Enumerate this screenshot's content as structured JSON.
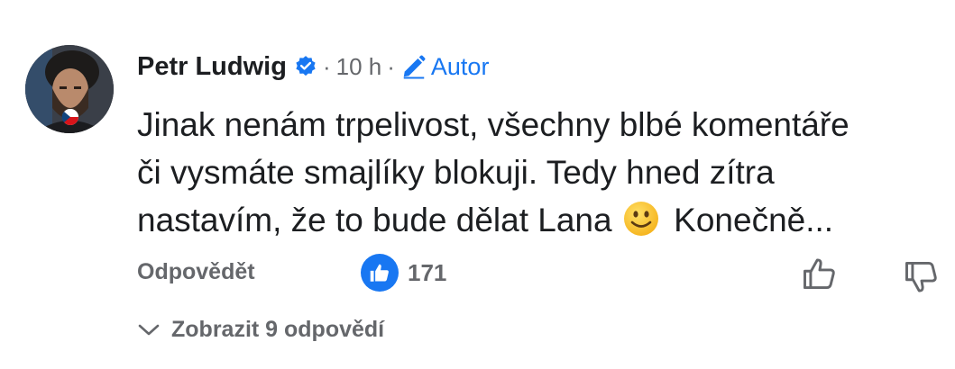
{
  "comment": {
    "author": "Petr Ludwig",
    "separator": "·",
    "time": "10 h",
    "author_tag": "Autor",
    "text_lines": [
      "Jinak nenám trpelivost, všechny blbé komentáře",
      "či vysmáte smajlíky blokuji. Tedy hned zítra",
      "nastavím, že to bude dělat Lana",
      "Konečně..."
    ]
  },
  "actions": {
    "reply_label": "Odpovědět",
    "like_count": "171"
  },
  "replies": {
    "label": "Zobrazit 9 odpovědí"
  },
  "icons": {
    "verified": "verified-badge-icon",
    "pencil": "pencil-icon",
    "like_reaction": "like-reaction-icon",
    "thumbs_up": "thumbs-up-icon",
    "thumbs_down": "thumbs-down-icon",
    "chevron": "chevron-down-icon",
    "emoji": "slightly-smiling-face-emoji",
    "flag": "czech-flag-icon"
  },
  "colors": {
    "accent": "#1877f2",
    "text": "#1c1e21",
    "muted": "#65676b"
  }
}
